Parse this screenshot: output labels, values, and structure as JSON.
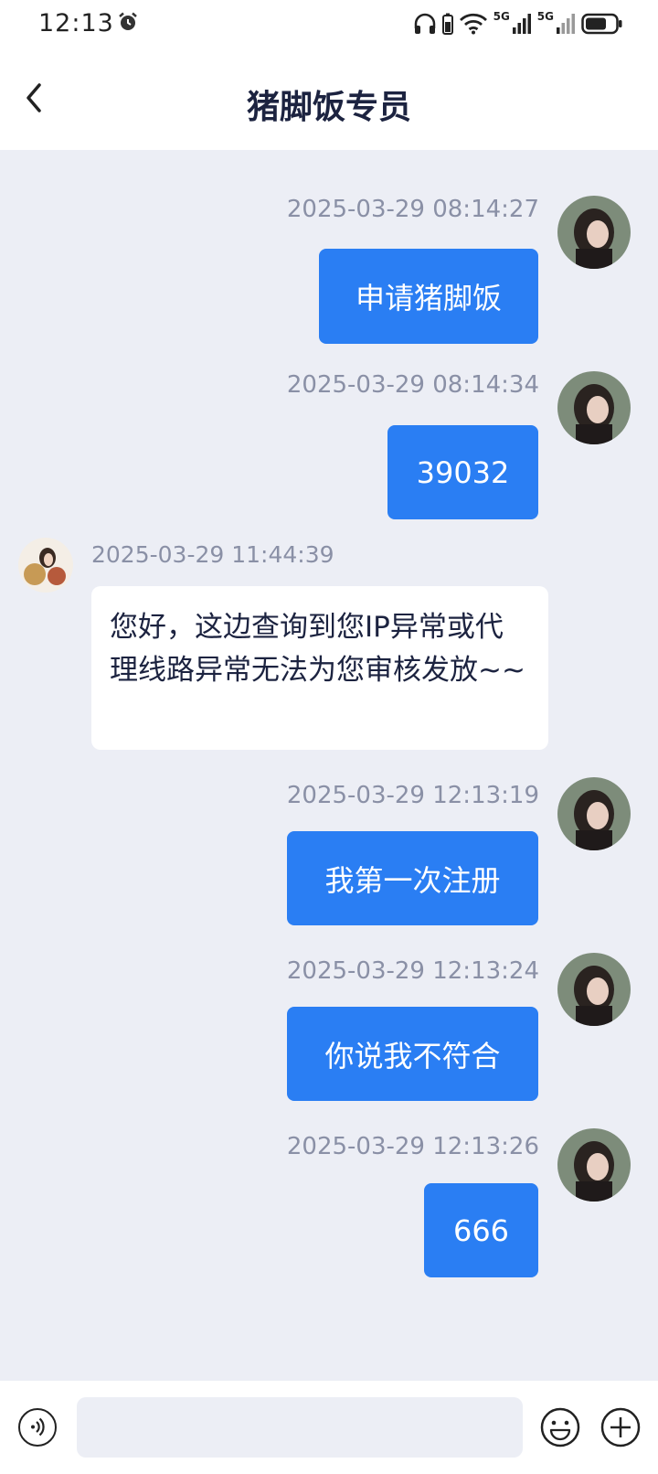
{
  "status_bar": {
    "time": "12:13",
    "network_label_1": "5G",
    "network_label_2": "5G"
  },
  "header": {
    "title": "猪脚饭专员"
  },
  "messages": [
    {
      "side": "out",
      "timestamp": "2025-03-29 08:14:27",
      "text": "申请猪脚饭"
    },
    {
      "side": "out",
      "timestamp": "2025-03-29 08:14:34",
      "text": "39032"
    },
    {
      "side": "in",
      "timestamp": "2025-03-29 11:44:39",
      "text": "您好，这边查询到您IP异常或代理线路异常无法为您审核发放~~"
    },
    {
      "side": "out",
      "timestamp": "2025-03-29 12:13:19",
      "text": "我第一次注册"
    },
    {
      "side": "out",
      "timestamp": "2025-03-29 12:13:24",
      "text": "你说我不符合"
    },
    {
      "side": "out",
      "timestamp": "2025-03-29 12:13:26",
      "text": "666"
    }
  ],
  "composer": {
    "placeholder": ""
  },
  "colors": {
    "accent": "#2a7ef3",
    "background": "#eceef5",
    "title": "#1c2340"
  },
  "icons": [
    "alarm-icon",
    "headphones-icon",
    "wifi-icon",
    "signal-icon",
    "battery-icon",
    "back-arrow-icon",
    "voice-icon",
    "emoji-icon",
    "plus-icon"
  ]
}
